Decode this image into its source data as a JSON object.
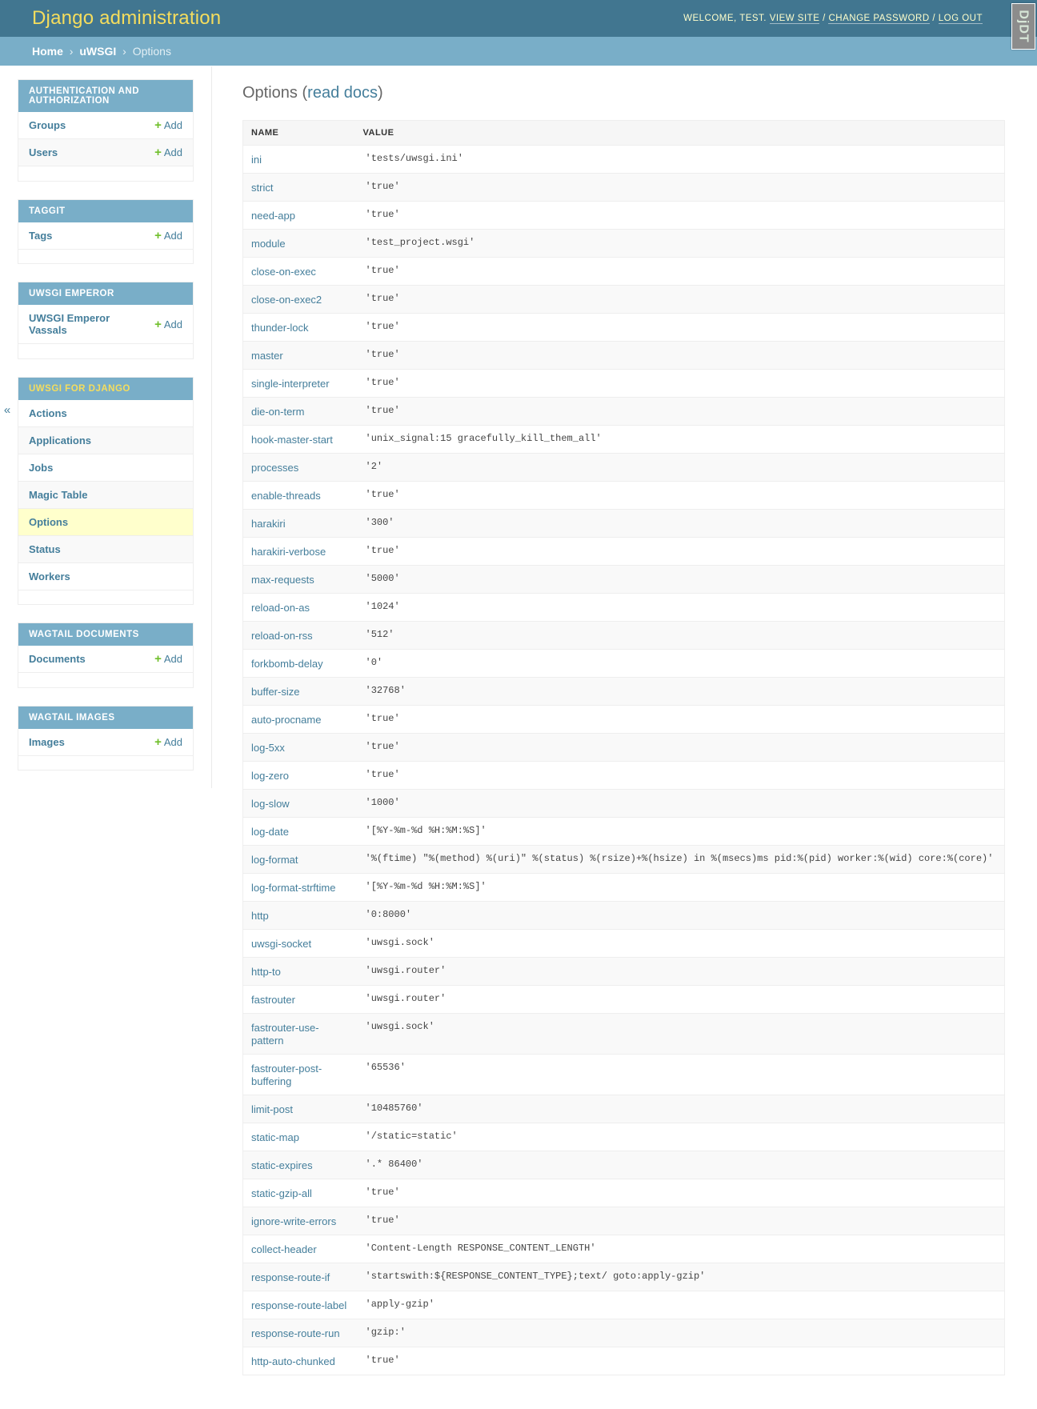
{
  "header": {
    "branding": "Django administration",
    "welcome": "WELCOME, TEST.",
    "view_site": "VIEW SITE",
    "change_password": "CHANGE PASSWORD",
    "log_out": "LOG OUT",
    "sep": "/",
    "djdt_label": "DjDT"
  },
  "breadcrumbs": {
    "home": "Home",
    "app": "uWSGI",
    "current": "Options",
    "sep": "›"
  },
  "sidebar": {
    "toggle_glyph": "«",
    "add_label": "Add",
    "plus_glyph": "+",
    "groups": [
      {
        "caption": "AUTHENTICATION AND AUTHORIZATION",
        "current": false,
        "items": [
          {
            "label": "Groups",
            "add": true
          },
          {
            "label": "Users",
            "add": true
          }
        ]
      },
      {
        "caption": "TAGGIT",
        "current": false,
        "items": [
          {
            "label": "Tags",
            "add": true
          }
        ]
      },
      {
        "caption": "UWSGI EMPEROR",
        "current": false,
        "items": [
          {
            "label": "UWSGI Emperor Vassals",
            "add": true
          }
        ]
      },
      {
        "caption": "UWSGI FOR DJANGO",
        "current": true,
        "items": [
          {
            "label": "Actions",
            "add": false
          },
          {
            "label": "Applications",
            "add": false
          },
          {
            "label": "Jobs",
            "add": false
          },
          {
            "label": "Magic Table",
            "add": false
          },
          {
            "label": "Options",
            "add": false,
            "selected": true
          },
          {
            "label": "Status",
            "add": false
          },
          {
            "label": "Workers",
            "add": false
          }
        ]
      },
      {
        "caption": "WAGTAIL DOCUMENTS",
        "current": false,
        "items": [
          {
            "label": "Documents",
            "add": true
          }
        ]
      },
      {
        "caption": "WAGTAIL IMAGES",
        "current": false,
        "items": [
          {
            "label": "Images",
            "add": true
          }
        ]
      }
    ]
  },
  "main": {
    "title": "Options",
    "title_link": "read docs",
    "title_paren_open": "(",
    "title_paren_close": ")",
    "columns": [
      "NAME",
      "VALUE"
    ],
    "rows": [
      {
        "name": "ini",
        "value": "'tests/uwsgi.ini'"
      },
      {
        "name": "strict",
        "value": "'true'"
      },
      {
        "name": "need-app",
        "value": "'true'"
      },
      {
        "name": "module",
        "value": "'test_project.wsgi'"
      },
      {
        "name": "close-on-exec",
        "value": "'true'"
      },
      {
        "name": "close-on-exec2",
        "value": "'true'"
      },
      {
        "name": "thunder-lock",
        "value": "'true'"
      },
      {
        "name": "master",
        "value": "'true'"
      },
      {
        "name": "single-interpreter",
        "value": "'true'"
      },
      {
        "name": "die-on-term",
        "value": "'true'"
      },
      {
        "name": "hook-master-start",
        "value": "'unix_signal:15 gracefully_kill_them_all'"
      },
      {
        "name": "processes",
        "value": "'2'"
      },
      {
        "name": "enable-threads",
        "value": "'true'"
      },
      {
        "name": "harakiri",
        "value": "'300'"
      },
      {
        "name": "harakiri-verbose",
        "value": "'true'"
      },
      {
        "name": "max-requests",
        "value": "'5000'"
      },
      {
        "name": "reload-on-as",
        "value": "'1024'"
      },
      {
        "name": "reload-on-rss",
        "value": "'512'"
      },
      {
        "name": "forkbomb-delay",
        "value": "'0'"
      },
      {
        "name": "buffer-size",
        "value": "'32768'"
      },
      {
        "name": "auto-procname",
        "value": "'true'"
      },
      {
        "name": "log-5xx",
        "value": "'true'"
      },
      {
        "name": "log-zero",
        "value": "'true'"
      },
      {
        "name": "log-slow",
        "value": "'1000'"
      },
      {
        "name": "log-date",
        "value": "'[%Y-%m-%d %H:%M:%S]'"
      },
      {
        "name": "log-format",
        "value": "'%(ftime) \"%(method) %(uri)\" %(status) %(rsize)+%(hsize) in %(msecs)ms pid:%(pid) worker:%(wid) core:%(core)'"
      },
      {
        "name": "log-format-strftime",
        "value": "'[%Y-%m-%d %H:%M:%S]'"
      },
      {
        "name": "http",
        "value": "'0:8000'"
      },
      {
        "name": "uwsgi-socket",
        "value": "'uwsgi.sock'"
      },
      {
        "name": "http-to",
        "value": "'uwsgi.router'"
      },
      {
        "name": "fastrouter",
        "value": "'uwsgi.router'"
      },
      {
        "name": "fastrouter-use-pattern",
        "value": "'uwsgi.sock'"
      },
      {
        "name": "fastrouter-post-buffering",
        "value": "'65536'"
      },
      {
        "name": "limit-post",
        "value": "'10485760'"
      },
      {
        "name": "static-map",
        "value": "'/static=static'"
      },
      {
        "name": "static-expires",
        "value": "'.* 86400'"
      },
      {
        "name": "static-gzip-all",
        "value": "'true'"
      },
      {
        "name": "ignore-write-errors",
        "value": "'true'"
      },
      {
        "name": "collect-header",
        "value": "'Content-Length RESPONSE_CONTENT_LENGTH'"
      },
      {
        "name": "response-route-if",
        "value": "'startswith:${RESPONSE_CONTENT_TYPE};text/ goto:apply-gzip'"
      },
      {
        "name": "response-route-label",
        "value": "'apply-gzip'"
      },
      {
        "name": "response-route-run",
        "value": "'gzip:'"
      },
      {
        "name": "http-auto-chunked",
        "value": "'true'"
      }
    ]
  }
}
